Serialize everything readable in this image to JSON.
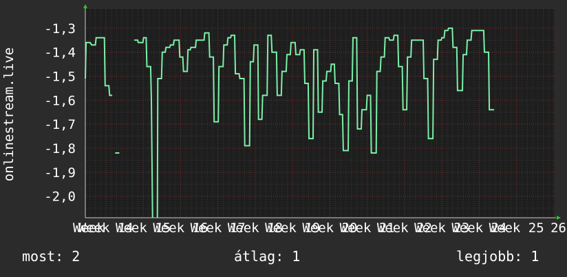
{
  "colors": {
    "background": "#2b2b2b",
    "plot_background": "#1e1e1e",
    "line": "#7cf0a8",
    "grid_minor": "#3a3a3a",
    "grid_major": "#7a2e2e",
    "arrow": "#22cc22",
    "text": "#ffffff"
  },
  "stats": {
    "now": "most: 2",
    "avg": "átlag: 1",
    "best": "legjobb: 1"
  },
  "chart_data": {
    "type": "line",
    "title": "",
    "xlabel": "",
    "ylabel": "onlinestream.live",
    "ylim": [
      -2.09,
      -1.22
    ],
    "xlim": [
      13.45,
      26.02
    ],
    "grid": true,
    "y_ticks": [
      {
        "value": -1.3,
        "label": "-1,3"
      },
      {
        "value": -1.4,
        "label": "-1,4"
      },
      {
        "value": -1.5,
        "label": "-1,5"
      },
      {
        "value": -1.6,
        "label": "-1,6"
      },
      {
        "value": -1.7,
        "label": "-1,7"
      },
      {
        "value": -1.8,
        "label": "-1,8"
      },
      {
        "value": -1.9,
        "label": "-1,9"
      },
      {
        "value": -2.0,
        "label": "-2,0"
      }
    ],
    "x_ticks": [
      {
        "value": 13.45,
        "label": "Week"
      },
      {
        "value": 14,
        "label": "Week 14"
      },
      {
        "value": 15,
        "label": "Week 15"
      },
      {
        "value": 16,
        "label": "Week 16"
      },
      {
        "value": 17,
        "label": "Week 17"
      },
      {
        "value": 18,
        "label": "Week 18"
      },
      {
        "value": 19,
        "label": "Week 19"
      },
      {
        "value": 20,
        "label": "Week 20"
      },
      {
        "value": 21,
        "label": "Week 21"
      },
      {
        "value": 22,
        "label": "Week 22"
      },
      {
        "value": 23,
        "label": "Week 23"
      },
      {
        "value": 24,
        "label": "Week 24"
      },
      {
        "value": 25,
        "label": "Week 25"
      },
      {
        "value": 26,
        "label": "26"
      }
    ],
    "series": [
      {
        "segments": [
          [
            [
              13.45,
              -1.51
            ],
            [
              13.47,
              -1.36
            ],
            [
              13.58,
              -1.36
            ],
            [
              13.62,
              -1.37
            ],
            [
              13.72,
              -1.37
            ],
            [
              13.74,
              -1.34
            ],
            [
              13.96,
              -1.34
            ],
            [
              13.98,
              -1.54
            ],
            [
              14.08,
              -1.54
            ],
            [
              14.1,
              -1.58
            ],
            [
              14.17,
              -1.58
            ]
          ],
          [
            [
              14.25,
              -1.82
            ],
            [
              14.36,
              -1.82
            ]
          ],
          [
            [
              14.76,
              -1.35
            ],
            [
              14.85,
              -1.35
            ],
            [
              14.87,
              -1.36
            ],
            [
              14.99,
              -1.36
            ],
            [
              15.01,
              -1.34
            ],
            [
              15.08,
              -1.34
            ],
            [
              15.1,
              -1.46
            ],
            [
              15.2,
              -1.46
            ],
            [
              15.22,
              -1.6
            ],
            [
              15.25,
              -2.09
            ]
          ],
          [
            [
              15.38,
              -2.09
            ],
            [
              15.39,
              -1.51
            ],
            [
              15.49,
              -1.51
            ],
            [
              15.51,
              -1.4
            ],
            [
              15.59,
              -1.4
            ],
            [
              15.61,
              -1.38
            ],
            [
              15.71,
              -1.38
            ],
            [
              15.73,
              -1.37
            ],
            [
              15.81,
              -1.37
            ],
            [
              15.83,
              -1.35
            ],
            [
              15.96,
              -1.35
            ],
            [
              15.98,
              -1.42
            ],
            [
              16.06,
              -1.42
            ],
            [
              16.08,
              -1.48
            ],
            [
              16.18,
              -1.48
            ],
            [
              16.2,
              -1.39
            ],
            [
              16.26,
              -1.39
            ],
            [
              16.28,
              -1.38
            ],
            [
              16.4,
              -1.38
            ],
            [
              16.42,
              -1.35
            ],
            [
              16.63,
              -1.35
            ],
            [
              16.65,
              -1.32
            ],
            [
              16.76,
              -1.32
            ],
            [
              16.78,
              -1.42
            ],
            [
              16.88,
              -1.42
            ],
            [
              16.9,
              -1.69
            ],
            [
              17.01,
              -1.69
            ],
            [
              17.03,
              -1.46
            ],
            [
              17.14,
              -1.46
            ],
            [
              17.16,
              -1.37
            ],
            [
              17.25,
              -1.37
            ],
            [
              17.27,
              -1.34
            ],
            [
              17.34,
              -1.34
            ],
            [
              17.36,
              -1.33
            ],
            [
              17.45,
              -1.33
            ],
            [
              17.47,
              -1.49
            ],
            [
              17.57,
              -1.49
            ],
            [
              17.59,
              -1.51
            ],
            [
              17.7,
              -1.51
            ],
            [
              17.72,
              -1.79
            ],
            [
              17.85,
              -1.79
            ],
            [
              17.87,
              -1.44
            ],
            [
              17.95,
              -1.44
            ],
            [
              17.97,
              -1.37
            ],
            [
              18.07,
              -1.37
            ],
            [
              18.09,
              -1.68
            ],
            [
              18.18,
              -1.68
            ],
            [
              18.2,
              -1.58
            ],
            [
              18.32,
              -1.58
            ],
            [
              18.34,
              -1.33
            ],
            [
              18.43,
              -1.33
            ],
            [
              18.45,
              -1.4
            ],
            [
              18.57,
              -1.4
            ],
            [
              18.59,
              -1.58
            ],
            [
              18.7,
              -1.58
            ],
            [
              18.72,
              -1.48
            ],
            [
              18.83,
              -1.48
            ],
            [
              18.85,
              -1.41
            ],
            [
              18.94,
              -1.41
            ],
            [
              18.96,
              -1.36
            ],
            [
              19.07,
              -1.36
            ],
            [
              19.09,
              -1.41
            ],
            [
              19.19,
              -1.41
            ],
            [
              19.21,
              -1.39
            ],
            [
              19.31,
              -1.39
            ],
            [
              19.33,
              -1.53
            ],
            [
              19.42,
              -1.53
            ],
            [
              19.44,
              -1.76
            ],
            [
              19.55,
              -1.76
            ],
            [
              19.57,
              -1.39
            ],
            [
              19.67,
              -1.39
            ],
            [
              19.69,
              -1.65
            ],
            [
              19.79,
              -1.65
            ],
            [
              19.81,
              -1.52
            ],
            [
              19.9,
              -1.52
            ],
            [
              19.92,
              -1.48
            ],
            [
              20.02,
              -1.48
            ],
            [
              20.04,
              -1.45
            ],
            [
              20.12,
              -1.45
            ],
            [
              20.14,
              -1.53
            ],
            [
              20.24,
              -1.53
            ],
            [
              20.26,
              -1.66
            ],
            [
              20.34,
              -1.66
            ],
            [
              20.36,
              -1.81
            ],
            [
              20.49,
              -1.81
            ],
            [
              20.51,
              -1.52
            ],
            [
              20.6,
              -1.52
            ],
            [
              20.62,
              -1.34
            ],
            [
              20.72,
              -1.34
            ],
            [
              20.74,
              -1.72
            ],
            [
              20.84,
              -1.72
            ],
            [
              20.86,
              -1.64
            ],
            [
              20.98,
              -1.64
            ],
            [
              21,
              -1.58
            ],
            [
              21.09,
              -1.58
            ],
            [
              21.11,
              -1.82
            ],
            [
              21.24,
              -1.82
            ],
            [
              21.26,
              -1.48
            ],
            [
              21.35,
              -1.48
            ],
            [
              21.37,
              -1.42
            ],
            [
              21.46,
              -1.42
            ],
            [
              21.48,
              -1.34
            ],
            [
              21.58,
              -1.34
            ],
            [
              21.6,
              -1.35
            ],
            [
              21.7,
              -1.35
            ],
            [
              21.72,
              -1.33
            ],
            [
              21.82,
              -1.33
            ],
            [
              21.84,
              -1.46
            ],
            [
              21.94,
              -1.46
            ],
            [
              21.96,
              -1.64
            ],
            [
              22.06,
              -1.64
            ],
            [
              22.08,
              -1.42
            ],
            [
              22.17,
              -1.42
            ],
            [
              22.19,
              -1.35
            ],
            [
              22.34,
              -1.35
            ],
            [
              22.36,
              -1.35
            ],
            [
              22.5,
              -1.35
            ],
            [
              22.52,
              -1.51
            ],
            [
              22.62,
              -1.51
            ],
            [
              22.64,
              -1.76
            ],
            [
              22.76,
              -1.76
            ],
            [
              22.78,
              -1.43
            ],
            [
              22.88,
              -1.43
            ],
            [
              22.9,
              -1.35
            ],
            [
              22.98,
              -1.35
            ],
            [
              23,
              -1.34
            ],
            [
              23.06,
              -1.34
            ],
            [
              23.08,
              -1.31
            ],
            [
              23.16,
              -1.31
            ],
            [
              23.18,
              -1.3
            ],
            [
              23.28,
              -1.3
            ],
            [
              23.3,
              -1.38
            ],
            [
              23.4,
              -1.38
            ],
            [
              23.42,
              -1.56
            ],
            [
              23.55,
              -1.56
            ],
            [
              23.57,
              -1.41
            ],
            [
              23.66,
              -1.41
            ],
            [
              23.68,
              -1.35
            ],
            [
              23.78,
              -1.35
            ],
            [
              23.8,
              -1.31
            ],
            [
              23.99,
              -1.31
            ],
            [
              24.01,
              -1.31
            ],
            [
              24.12,
              -1.31
            ],
            [
              24.14,
              -1.4
            ],
            [
              24.25,
              -1.4
            ],
            [
              24.27,
              -1.64
            ],
            [
              24.4,
              -1.64
            ]
          ]
        ]
      }
    ]
  }
}
